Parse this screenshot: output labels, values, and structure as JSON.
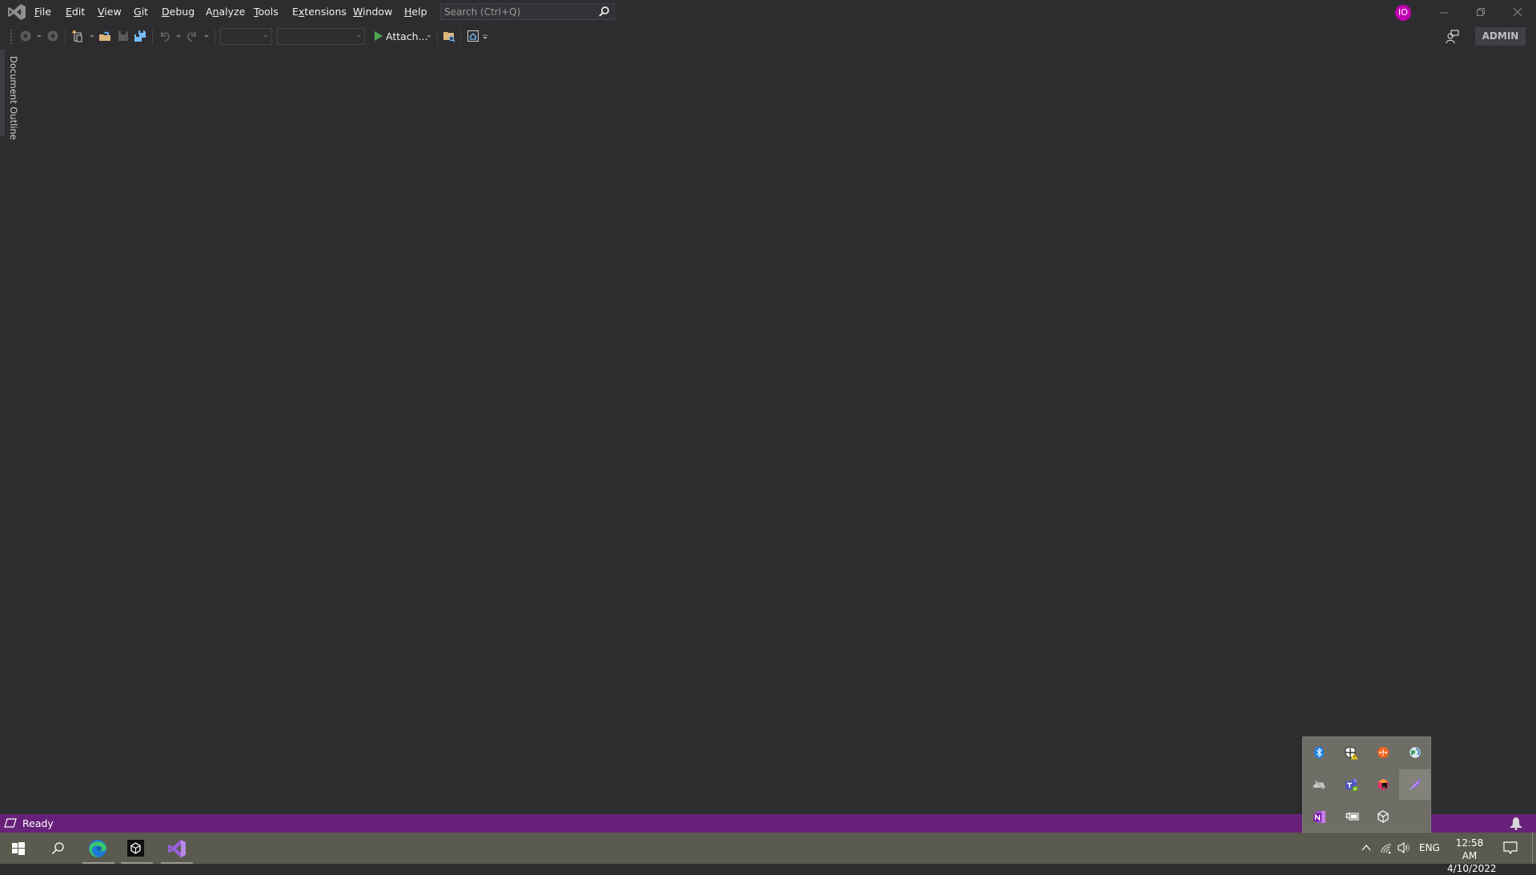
{
  "window": {
    "app_name": "Visual Studio",
    "menu": [
      {
        "label": "File",
        "mnemonic": "F",
        "rest": "ile"
      },
      {
        "label": "Edit",
        "mnemonic": "E",
        "rest": "dit"
      },
      {
        "label": "View",
        "mnemonic": "V",
        "rest": "iew"
      },
      {
        "label": "Git",
        "mnemonic": "G",
        "rest": "it"
      },
      {
        "label": "Debug",
        "mnemonic": "D",
        "rest": "ebug"
      },
      {
        "label": "Analyze",
        "pre": "A",
        "mnemonic": "n",
        "rest": "alyze"
      },
      {
        "label": "Tools",
        "mnemonic": "T",
        "rest": "ools"
      },
      {
        "label": "Extensions",
        "pre": "E",
        "mnemonic": "x",
        "rest": "tensions"
      },
      {
        "label": "Window",
        "mnemonic": "W",
        "rest": "indow"
      },
      {
        "label": "Help",
        "mnemonic": "H",
        "rest": "elp"
      }
    ],
    "search": {
      "placeholder": "Search (Ctrl+Q)",
      "value": ""
    },
    "account_initials": "IO",
    "account_color": "#c000b0",
    "controls": {
      "minimize": "minimize-icon",
      "restore": "restore-icon",
      "close": "close-icon"
    }
  },
  "toolbar": {
    "items": [
      "navigate-back-icon",
      "navigate-forward-icon",
      "new-project-icon",
      "open-file-icon",
      "save-icon",
      "save-all-icon",
      "undo-icon",
      "redo-icon"
    ],
    "solution_configuration": "",
    "solution_platform": "",
    "attach_label": "Attach...",
    "admin_badge": "ADMIN"
  },
  "side_tabs": {
    "document_outline": "Document Outline"
  },
  "status_bar": {
    "text": "Ready",
    "color": "#68217a"
  },
  "taskbar": {
    "apps": [
      "windows-start-icon",
      "search-icon",
      "edge-icon",
      "unity-icon",
      "visual-studio-icon"
    ],
    "language": "ENG",
    "time": "12:58 AM",
    "date": "4/10/2022"
  },
  "tray_flyout": {
    "icons": [
      "bluetooth-icon",
      "defender-warning-icon",
      "orange-app-icon",
      "globe-sync-icon",
      "onedrive-off-icon",
      "teams-icon",
      "cube-app-icon",
      "feather-icon",
      "onenote-icon",
      "battery-plugged-icon",
      "unity-hub-icon"
    ]
  }
}
